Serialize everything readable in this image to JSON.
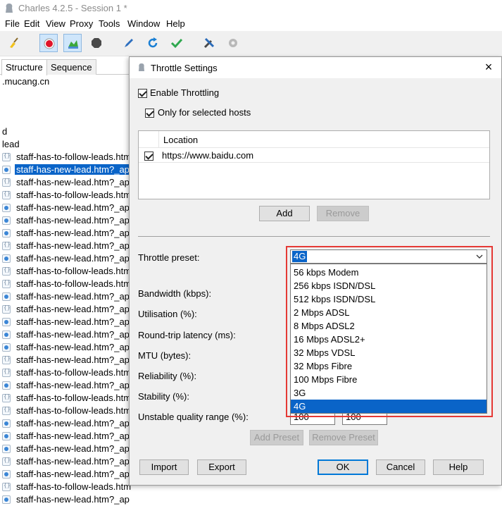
{
  "window": {
    "title": "Charles 4.2.5 - Session 1 *"
  },
  "menu": [
    "File",
    "Edit",
    "View",
    "Proxy",
    "Tools",
    "Window",
    "Help"
  ],
  "toolbar": {
    "icons": [
      "broom-icon",
      "record-icon",
      "throttle-icon",
      "breakpoint-icon",
      "compose-icon",
      "repeat-icon",
      "validate-icon",
      "tools-icon",
      "settings-icon"
    ]
  },
  "left_pane": {
    "tabs": [
      "Structure",
      "Sequence"
    ],
    "host": ".mucang.cn",
    "node_d": "d",
    "node_lead": "lead",
    "rows": [
      {
        "label": "staff-has-to-follow-leads.htm",
        "icon": "doc",
        "selected": false
      },
      {
        "label": "staff-has-new-lead.htm?_ap",
        "icon": "req",
        "selected": true
      },
      {
        "label": "staff-has-new-lead.htm?_ap",
        "icon": "doc",
        "selected": false
      },
      {
        "label": "staff-has-to-follow-leads.htm",
        "icon": "doc",
        "selected": false
      },
      {
        "label": "staff-has-new-lead.htm?_ap",
        "icon": "req",
        "selected": false
      },
      {
        "label": "staff-has-new-lead.htm?_ap",
        "icon": "req",
        "selected": false
      },
      {
        "label": "staff-has-new-lead.htm?_ap",
        "icon": "req",
        "selected": false
      },
      {
        "label": "staff-has-new-lead.htm?_ap",
        "icon": "doc",
        "selected": false
      },
      {
        "label": "staff-has-new-lead.htm?_ap",
        "icon": "req",
        "selected": false
      },
      {
        "label": "staff-has-to-follow-leads.htm",
        "icon": "doc",
        "selected": false
      },
      {
        "label": "staff-has-to-follow-leads.htm",
        "icon": "doc",
        "selected": false
      },
      {
        "label": "staff-has-new-lead.htm?_ap",
        "icon": "req",
        "selected": false
      },
      {
        "label": "staff-has-new-lead.htm?_ap",
        "icon": "doc",
        "selected": false
      },
      {
        "label": "staff-has-new-lead.htm?_ap",
        "icon": "req",
        "selected": false
      },
      {
        "label": "staff-has-new-lead.htm?_ap",
        "icon": "req",
        "selected": false
      },
      {
        "label": "staff-has-new-lead.htm?_ap",
        "icon": "req",
        "selected": false
      },
      {
        "label": "staff-has-new-lead.htm?_ap",
        "icon": "doc",
        "selected": false
      },
      {
        "label": "staff-has-to-follow-leads.htm",
        "icon": "doc",
        "selected": false
      },
      {
        "label": "staff-has-new-lead.htm?_ap",
        "icon": "req",
        "selected": false
      },
      {
        "label": "staff-has-to-follow-leads.htm",
        "icon": "doc",
        "selected": false
      },
      {
        "label": "staff-has-to-follow-leads.htm",
        "icon": "doc",
        "selected": false
      },
      {
        "label": "staff-has-new-lead.htm?_ap",
        "icon": "req",
        "selected": false
      },
      {
        "label": "staff-has-new-lead.htm?_ap",
        "icon": "req",
        "selected": false
      },
      {
        "label": "staff-has-new-lead.htm?_ap",
        "icon": "req",
        "selected": false
      },
      {
        "label": "staff-has-new-lead.htm?_ap",
        "icon": "doc",
        "selected": false
      },
      {
        "label": "staff-has-new-lead.htm?_ap",
        "icon": "req",
        "selected": false
      },
      {
        "label": "staff-has-to-follow-leads.htm",
        "icon": "doc",
        "selected": false
      },
      {
        "label": "staff-has-new-lead.htm?_ap",
        "icon": "req",
        "selected": false
      }
    ]
  },
  "dialog": {
    "title": "Throttle Settings",
    "enable_throttling": "Enable Throttling",
    "only_selected_hosts": "Only for selected hosts",
    "hosts_table": {
      "column": "Location",
      "rows": [
        "https://www.baidu.com"
      ]
    },
    "add_label": "Add",
    "remove_label": "Remove",
    "throttle_preset_label": "Throttle preset:",
    "preset_selected": "4G",
    "preset_options": [
      "56 kbps Modem",
      "256 kbps ISDN/DSL",
      "512 kbps ISDN/DSL",
      "2 Mbps ADSL",
      "8 Mbps ADSL2",
      "16 Mbps ADSL2+",
      "32 Mbps VDSL",
      "32 Mbps Fibre",
      "100 Mbps Fibre",
      "3G",
      "4G"
    ],
    "fields": {
      "bandwidth": "Bandwidth (kbps):",
      "utilisation": "Utilisation (%):",
      "latency": "Round-trip latency (ms):",
      "mtu": "MTU (bytes):",
      "reliability": "Reliability (%):",
      "stability": "Stability (%):",
      "unstable_range": "Unstable quality range (%):"
    },
    "unstable_min": "100",
    "unstable_max": "100",
    "add_preset_label": "Add Preset",
    "remove_preset_label": "Remove Preset",
    "import_label": "Import",
    "export_label": "Export",
    "ok_label": "OK",
    "cancel_label": "Cancel",
    "help_label": "Help"
  },
  "colors": {
    "selection": "#0a64c8",
    "highlight_box": "#e53935"
  }
}
